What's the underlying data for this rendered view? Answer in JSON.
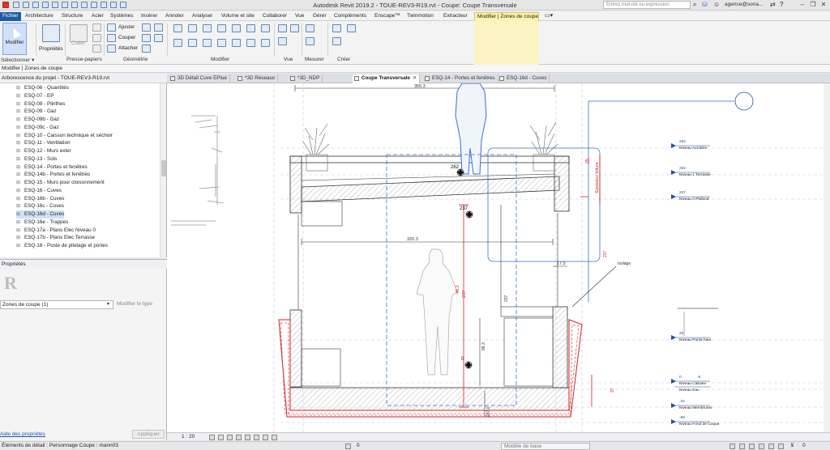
{
  "titlebar": {
    "app_title": "Autodesk Revit 2019.2 - TOUE-REV3-R19.rvt - Coupe: Coupe Transversale",
    "search_placeholder": "Entrez mot-clé ou expression",
    "user": "agence@sona..."
  },
  "ribbon_tabs": [
    "Fichier",
    "Architecture",
    "Structure",
    "Acier",
    "Systèmes",
    "Insérer",
    "Annoter",
    "Analyser",
    "Volume et site",
    "Collaborer",
    "Vue",
    "Gérer",
    "Compléments",
    "Enscape™",
    "Twinmotion",
    "Extracteur",
    "Modifier | Zones de coupe"
  ],
  "ribbon": {
    "modifier": "Modifier",
    "proprietes": "Propriétés",
    "coller": "Coller",
    "ajuster": "Ajuster",
    "couper": "Couper",
    "attacher": "Attacher",
    "groups": {
      "selectionner": "Sélectionner ▾",
      "proprietes": "Propriétés",
      "presse_papiers": "Presse-papiers",
      "geometrie": "Géométrie",
      "modifier": "Modifier",
      "vue": "Vue",
      "mesurer": "Mesurer",
      "creer": "Créer"
    }
  },
  "context_bar": "Modifier | Zones de coupe",
  "project_browser": {
    "title": "Arborescence du projet - TOUE-REV3-R19.rvt",
    "items": [
      "ESQ-06 - Quantités",
      "ESQ-07 - EP",
      "ESQ-08 - Plinthes",
      "ESQ-09 - Gaz",
      "ESQ-09b - Gaz",
      "ESQ-09c - Gaz",
      "ESQ-10 - Caisson technique et séchoir",
      "ESQ-11 - Ventilation",
      "ESQ-12 - Murs exter",
      "ESQ-13 - Sols",
      "ESQ-14 - Portes et fenêtres",
      "ESQ-14b - Portes et fenêtres",
      "ESQ-15 - Murs pour cloisonnement",
      "ESQ-16 - Cuves",
      "ESQ-16b - Cuves",
      "ESQ-16c - Cuves",
      "ESQ-16d - Cuves",
      "ESQ-16e - Trappes",
      "ESQ-17a - Plans Elec Niveau 0",
      "ESQ-17b - Plans Elec Terrasse",
      "ESQ-18 - Poste de pilotage et portes"
    ],
    "selected_index": 16
  },
  "properties": {
    "title": "Propriétés",
    "type_selector": "Zones de coupe (1)",
    "edit_type": "Modifier le type",
    "help_link": "Aide des propriétés",
    "apply": "Appliquer"
  },
  "view_tabs": [
    "3D Détail Cuve EPlue",
    "*3D Réseaux",
    "*3D_NDP",
    "Coupe Transversale",
    "ESQ-14 - Portes et fenêtres",
    "ESQ-16d - Cuves"
  ],
  "active_view_index": 3,
  "view_control": {
    "scale": "1 : 20"
  },
  "status": {
    "text": "Éléments de détail : Personnage Coupe : mann03",
    "model": "Modèle de base",
    "zero": "0"
  },
  "drawing": {
    "dimensions": {
      "top": "355.3",
      "mid": "320.3",
      "small": "17.5",
      "vert1": "237",
      "vert2": "98.3",
      "vert3": "227.0",
      "vert4": "37",
      "red1": "46.2",
      "red2": "237",
      "vert_red": "Epaisseur toiture",
      "r1": "25",
      "r2": "17.5",
      "r3": "227",
      "r4": "237",
      "r5": "187.5"
    },
    "tags": {
      "t1": "262",
      "t2": "237",
      "t3": "0"
    },
    "note": "Isolage",
    "levels": [
      {
        "value": "282",
        "name": "Niveau Acrotère"
      },
      {
        "value": "262",
        "name": "Niveau 1 Terrasse"
      },
      {
        "value": "237",
        "name": "Niveau 0 Plafond"
      },
      {
        "value": "20",
        "name": "Niveau Ponts haut"
      },
      {
        "value": "0",
        "name": "Niveau Cabane"
      },
      {
        "value": "-5",
        "name": "Niveau Eau"
      },
      {
        "value": "-32",
        "name": "Niveau Membrures"
      },
      {
        "value": "-68",
        "name": "Niveau Fond de Coque"
      }
    ]
  },
  "colors": {
    "file_tab": "#1e5ba6",
    "context_tab": "#fdf2a8",
    "dimension_red": "#d22020",
    "level_blue": "#1f4fa8",
    "selection_blue": "#3b6fd4"
  }
}
